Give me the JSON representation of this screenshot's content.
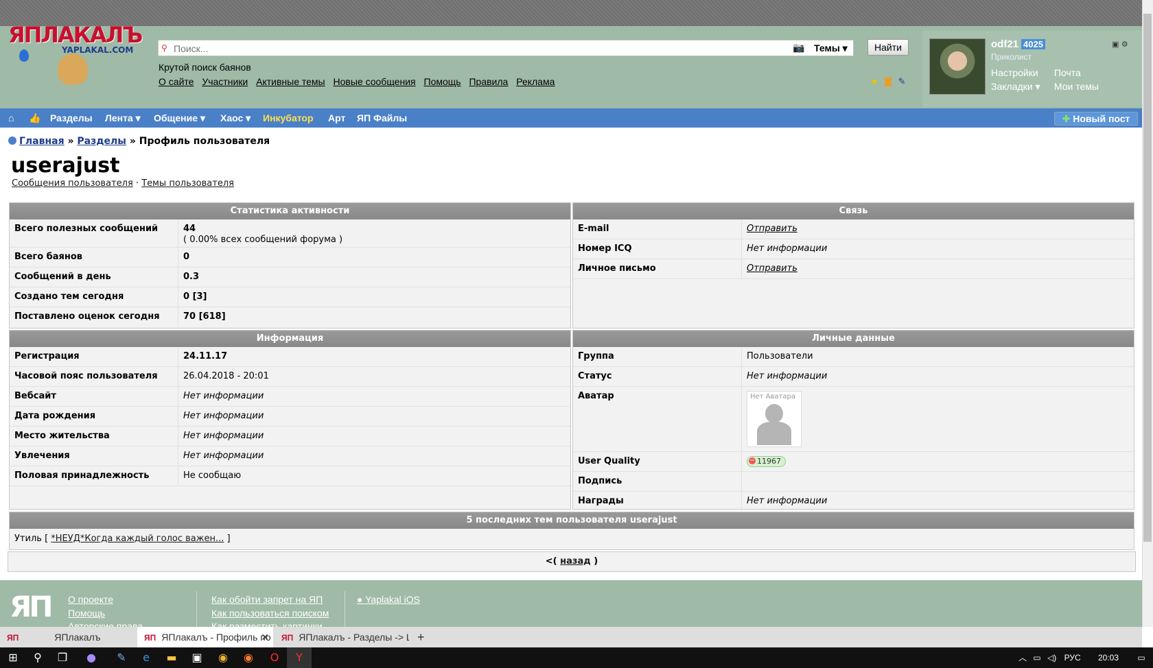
{
  "header": {
    "logo_text": "ЯПЛАКАЛЪ",
    "logo_sub": "YAPLAKAL.COM",
    "search_placeholder": "Поиск...",
    "search_scope": "Темы",
    "find_button": "Найти",
    "tagline": "Крутой поиск баянов",
    "links": [
      "О сайте",
      "Участники",
      "Активные темы",
      "Новые сообщения",
      "Помощь",
      "Правила",
      "Реклама"
    ]
  },
  "user": {
    "name": "odf21",
    "count": "4025",
    "rank": "Приколист",
    "settings": "Настройки",
    "mail": "Почта",
    "bookmarks": "Закладки",
    "my_topics": "Мои темы"
  },
  "nav": {
    "items": [
      "Разделы",
      "Лента",
      "Общение",
      "Хаос",
      "Инкубатор",
      "Арт",
      "ЯП Файлы"
    ],
    "new_post": "Новый пост"
  },
  "breadcrumb": {
    "home": "Главная",
    "sections": "Разделы",
    "current": "» Профиль пользователя",
    "sep": "»"
  },
  "profile": {
    "username": "userajust",
    "user_posts_link": "Сообщения пользователя",
    "user_topics_link": "Темы пользователя",
    "dot": "·"
  },
  "activity": {
    "title": "Статистика активности",
    "rows": [
      {
        "k": "Всего полезных сообщений",
        "v": "44",
        "v2": "( 0.00% всех сообщений форума )"
      },
      {
        "k": "Всего баянов",
        "v": "0"
      },
      {
        "k": "Сообщений в день",
        "v": "0.3"
      },
      {
        "k": "Создано тем сегодня",
        "v": "0 [3]"
      },
      {
        "k": "Поставлено оценок сегодня",
        "v": "70 [618]"
      }
    ]
  },
  "contact": {
    "title": "Связь",
    "rows": [
      {
        "k": "E-mail",
        "v": "Отправить"
      },
      {
        "k": "Номер ICQ",
        "v": "Нет информации"
      },
      {
        "k": "Личное письмо",
        "v": "Отправить"
      }
    ]
  },
  "info": {
    "title": "Информация",
    "rows": [
      {
        "k": "Регистрация",
        "v": "24.11.17"
      },
      {
        "k": "Часовой пояс пользователя",
        "v": "26.04.2018 - 20:01"
      },
      {
        "k": "Вебсайт",
        "v": "Нет информации"
      },
      {
        "k": "Дата рождения",
        "v": "Нет информации"
      },
      {
        "k": "Место жительства",
        "v": "Нет информации"
      },
      {
        "k": "Увлечения",
        "v": "Нет информации"
      },
      {
        "k": "Половая принадлежность",
        "v": "Не сообщаю"
      }
    ]
  },
  "personal": {
    "title": "Личные данные",
    "rows": [
      {
        "k": "Группа",
        "v": "Пользователи"
      },
      {
        "k": "Статус",
        "v": "Нет информации"
      },
      {
        "k": "Аватар",
        "v": "Нет Аватара"
      },
      {
        "k": "User Quality",
        "v": "11967"
      },
      {
        "k": "Подпись",
        "v": ""
      },
      {
        "k": "Награды",
        "v": "Нет информации"
      }
    ]
  },
  "recent": {
    "title": "5 последних тем пользователя userajust",
    "forum": "Утиль",
    "topic": "*НЕУД*Когда каждый голос важен...",
    "open": "[",
    "close": "]"
  },
  "back": {
    "prefix": "<(",
    "label": "назад",
    "suffix": ")"
  },
  "footer": {
    "logo": "ЯП",
    "col1": [
      "О проекте",
      "Помощь",
      "Авторские права"
    ],
    "col2": [
      "Как обойти запрет на ЯП",
      "Как пользоваться поиском",
      "Как разместить картинки"
    ],
    "col3": "Yaplakal iOS"
  },
  "tabs": [
    {
      "title": "ЯПлакалъ"
    },
    {
      "title": "ЯПлакалъ - Профиль по"
    },
    {
      "title": "ЯПлакалъ - Разделы -> Цит"
    }
  ],
  "taskbar": {
    "lang": "РУС",
    "time": "20:03"
  },
  "colors": {
    "header_bg": "#9fbaa6",
    "nav_bg": "#4a80c8",
    "incubator": "#ffe14d",
    "panel_head": "#8f8f8f"
  }
}
